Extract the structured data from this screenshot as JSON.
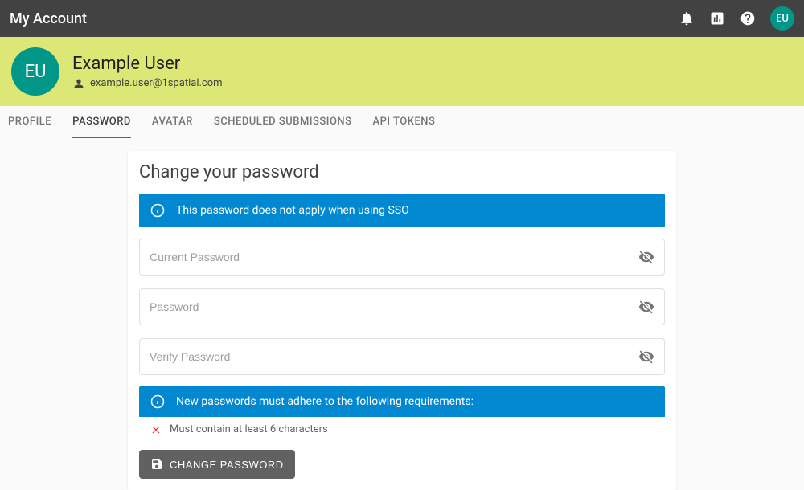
{
  "topbar": {
    "title": "My Account",
    "avatar_initials": "EU"
  },
  "banner": {
    "avatar_initials": "EU",
    "name": "Example User",
    "email": "example.user@1spatial.com"
  },
  "tabs": [
    {
      "label": "PROFILE",
      "active": false
    },
    {
      "label": "PASSWORD",
      "active": true
    },
    {
      "label": "AVATAR",
      "active": false
    },
    {
      "label": "SCHEDULED SUBMISSIONS",
      "active": false
    },
    {
      "label": "API TOKENS",
      "active": false
    }
  ],
  "card": {
    "title": "Change your password",
    "sso_notice": "This password does not apply when using SSO",
    "fields": {
      "current": {
        "placeholder": "Current Password"
      },
      "new": {
        "placeholder": "Password"
      },
      "verify": {
        "placeholder": "Verify Password"
      }
    },
    "requirements_header": "New passwords must adhere to the following requirements:",
    "requirements": [
      {
        "text": "Must contain at least 6 characters",
        "met": false
      }
    ],
    "submit_label": "CHANGE PASSWORD"
  }
}
